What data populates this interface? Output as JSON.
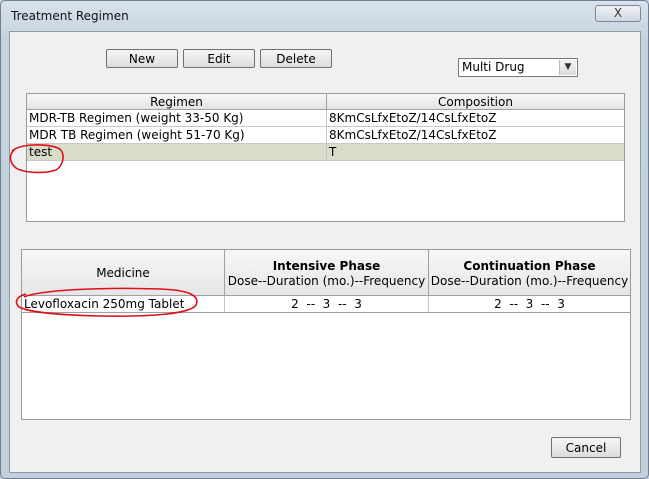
{
  "window": {
    "title": "Treatment Regimen",
    "close_glyph": "X"
  },
  "toolbar": {
    "new_label": "New",
    "edit_label": "Edit",
    "delete_label": "Delete"
  },
  "drug_type": {
    "selected": "Multi Drug"
  },
  "regimen_table": {
    "headers": [
      "Regimen",
      "Composition"
    ],
    "rows": [
      {
        "regimen": "MDR-TB Regimen (weight 33-50 Kg)",
        "composition": "8KmCsLfxEtoZ/14CsLfxEtoZ"
      },
      {
        "regimen": "MDR TB Regimen (weight 51-70 Kg)",
        "composition": "8KmCsLfxEtoZ/14CsLfxEtoZ"
      },
      {
        "regimen": "test",
        "composition": "T",
        "selected": true
      }
    ]
  },
  "medicine_table": {
    "medicine_header": "Medicine",
    "intensive_title": "Intensive Phase",
    "intensive_sub": "Dose--Duration (mo.)--Frequency",
    "continuation_title": "Continuation Phase",
    "continuation_sub": "Dose--Duration (mo.)--Frequency",
    "rows": [
      {
        "medicine": "Levofloxacin 250mg Tablet",
        "intensive": "2  --  3  --  3",
        "continuation": "2  --  3  --  3"
      }
    ]
  },
  "footer": {
    "cancel_label": "Cancel"
  },
  "colors": {
    "annotation": "#e0101a",
    "selected_row": "#d9dcc9"
  }
}
